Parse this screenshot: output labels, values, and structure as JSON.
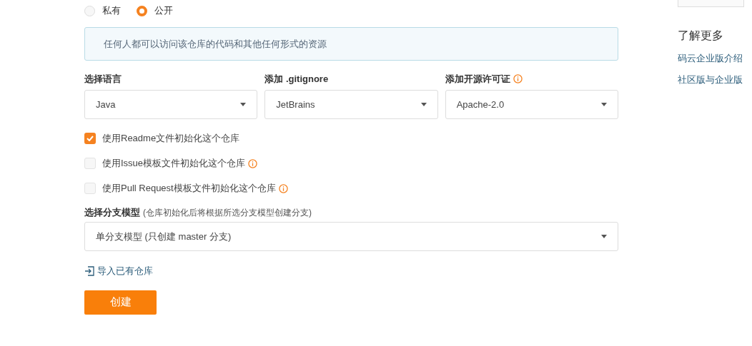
{
  "visibility": {
    "options": [
      {
        "label": "私有",
        "selected": false
      },
      {
        "label": "公开",
        "selected": true
      }
    ],
    "notice": "任何人都可以访问该仓库的代码和其他任何形式的资源"
  },
  "selects": [
    {
      "label": "选择语言",
      "value": "Java",
      "info": false
    },
    {
      "label": "添加 .gitignore",
      "value": "JetBrains",
      "info": false
    },
    {
      "label": "添加开源许可证",
      "value": "Apache-2.0",
      "info": true
    }
  ],
  "checkboxes": [
    {
      "label": "使用Readme文件初始化这个仓库",
      "checked": true,
      "info": false
    },
    {
      "label": "使用Issue模板文件初始化这个仓库",
      "checked": false,
      "info": true
    },
    {
      "label": "使用Pull Request模板文件初始化这个仓库",
      "checked": false,
      "info": true
    }
  ],
  "branch": {
    "label": "选择分支模型",
    "hint": "(仓库初始化后将根据所选分支模型创建分支)",
    "value": "单分支模型 (只创建 master 分支)"
  },
  "import_link": "导入已有仓库",
  "create_button": "创建",
  "sidebar": {
    "heading": "了解更多",
    "links": [
      "码云企业版介绍",
      "社区版与企业版"
    ]
  }
}
